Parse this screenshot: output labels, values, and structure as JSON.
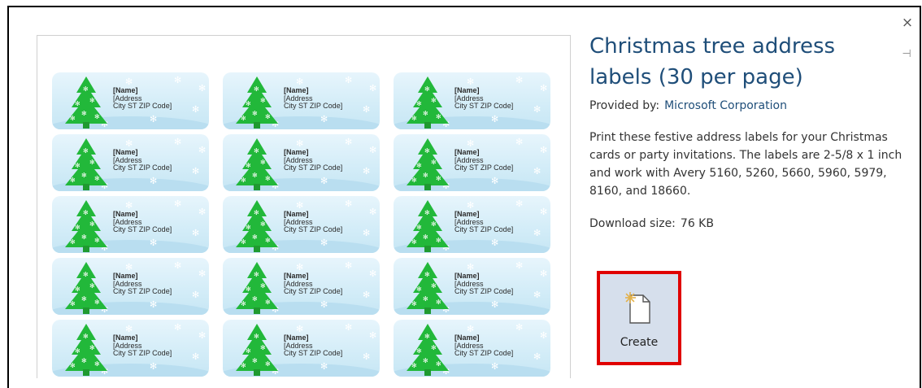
{
  "dialog": {
    "close_symbol": "×",
    "pin_symbol": "⊣"
  },
  "preview": {
    "label_name": "[Name]",
    "label_address": "[Address",
    "label_city": "City ST  ZIP Code]"
  },
  "template": {
    "title": "Christmas tree address labels (30 per page)",
    "provided_by_label": "Provided by:",
    "provider": "Microsoft Corporation",
    "description": "Print these festive address labels for your Christmas cards or party invitations. The labels are 2-5/8 x 1 inch and work with Avery 5160, 5260, 5660, 5960, 5979, 8160, and 18660.",
    "download_size_label": "Download size:",
    "download_size": "76 KB"
  },
  "actions": {
    "create_label": "Create"
  },
  "colors": {
    "title": "#1f4e79",
    "tree": "#22b83a",
    "highlight_border": "#e00000"
  },
  "icons": {
    "close": "close-icon",
    "pin": "pin-icon",
    "create": "new-document-icon"
  }
}
